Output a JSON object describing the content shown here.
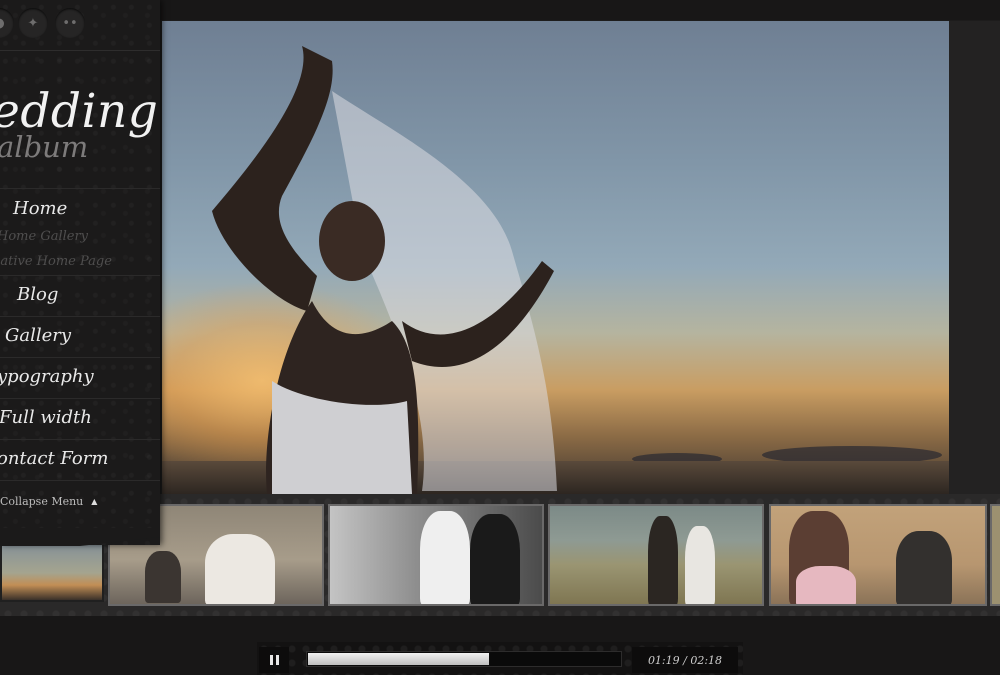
{
  "social": {
    "icons": [
      "social-icon",
      "twitter-icon",
      "flickr-icon"
    ]
  },
  "logo": {
    "line1": "edding",
    "line2": "album"
  },
  "menu": {
    "home": "Home",
    "home_sub": [
      "Home Gallery",
      "native Home Page"
    ],
    "items": [
      "Blog",
      "Gallery",
      "ypography",
      "Full width",
      "ontact Form"
    ]
  },
  "collapse_label": "Collapse Menu",
  "player": {
    "time": "01:19 / 02:18",
    "progress": 0.58
  },
  "colors": {
    "background": "#1d1c1c",
    "sidebar": "#1b1a1a",
    "strip": "#2a2929",
    "text": "#e9e9e9"
  }
}
